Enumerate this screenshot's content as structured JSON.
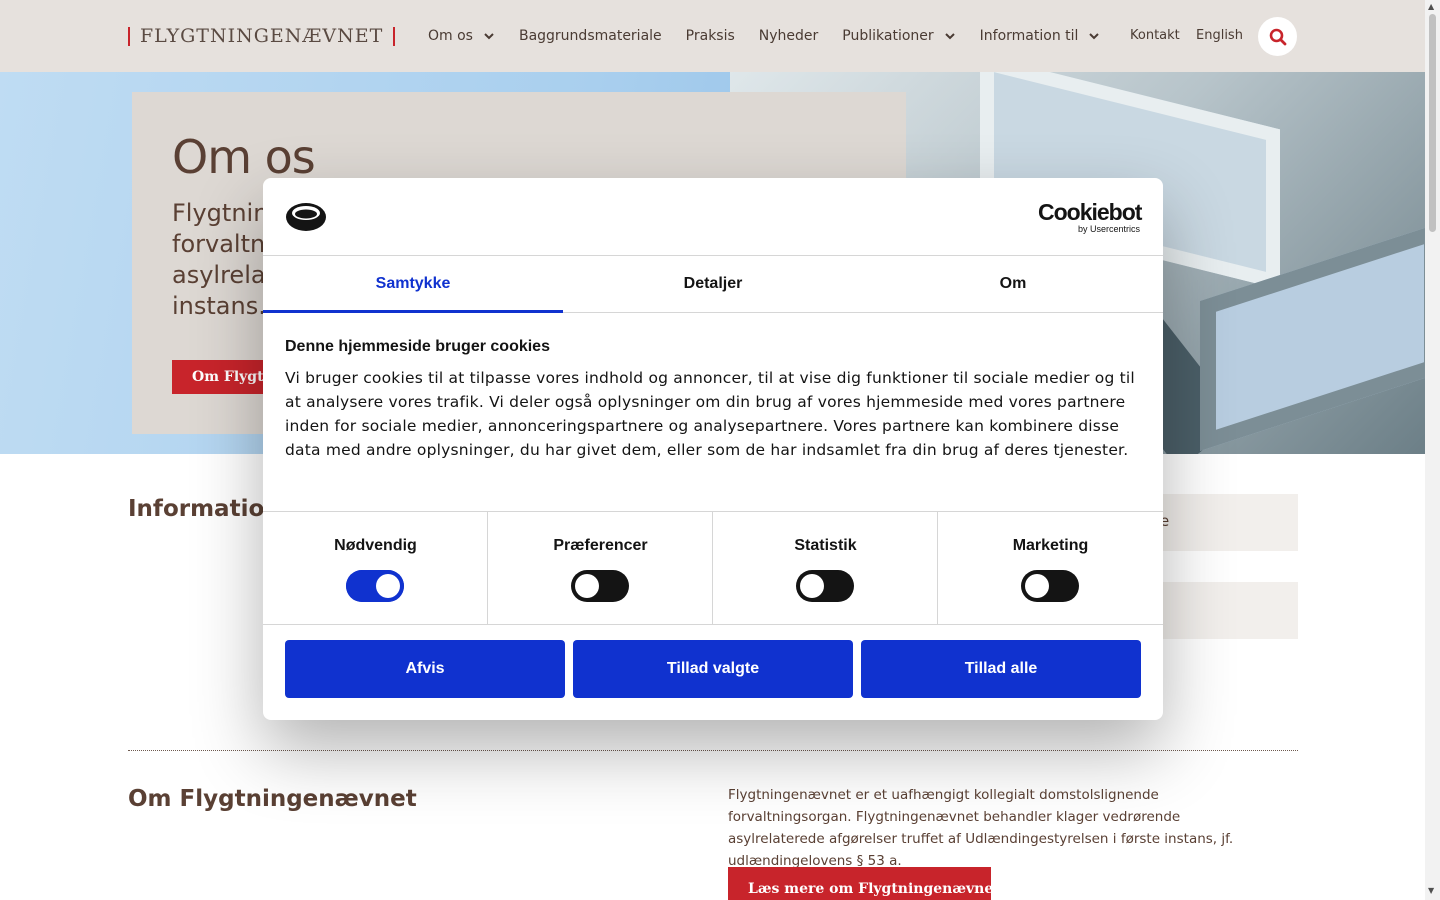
{
  "header": {
    "logo_text": "FLYGTNINGENÆVNET",
    "nav": [
      {
        "label": "Om os",
        "has_dropdown": true
      },
      {
        "label": "Baggrundsmateriale",
        "has_dropdown": false
      },
      {
        "label": "Praksis",
        "has_dropdown": false
      },
      {
        "label": "Nyheder",
        "has_dropdown": false
      },
      {
        "label": "Publikationer",
        "has_dropdown": true
      },
      {
        "label": "Information til",
        "has_dropdown": true
      }
    ],
    "contact": "Kontakt",
    "language": "English",
    "search_icon": "search-icon"
  },
  "hero": {
    "title": "Om os",
    "lead_lines": [
      "Flygtning",
      "forvaltnir",
      "asylrelate",
      "instans."
    ],
    "cta": "Om Flygtn"
  },
  "section": {
    "info_heading": "Information t",
    "side_cards": [
      "e",
      ""
    ]
  },
  "about": {
    "heading": "Om Flygtningenævnet",
    "text": "Flygtningenævnet er et uafhængigt kollegialt domstolslignende forvaltningsorgan. Flygtningenævnet behandler klager vedrørende asylrelaterede afgørelser truffet af Udlændingestyrelsen i første instans, jf. udlændingelovens § 53 a.",
    "cta": "Læs mere om Flygtningenævnet"
  },
  "cookie_dialog": {
    "brand": "Cookiebot",
    "brand_sub": "by Usercentrics",
    "tabs": [
      {
        "label": "Samtykke",
        "active": true
      },
      {
        "label": "Detaljer",
        "active": false
      },
      {
        "label": "Om",
        "active": false
      }
    ],
    "title": "Denne hjemmeside bruger cookies",
    "body": "Vi bruger cookies til at tilpasse vores indhold og annoncer, til at vise dig funktioner til sociale medier og til at analysere vores trafik. Vi deler også oplysninger om din brug af vores hjemmeside med vores partnere inden for sociale medier, annonceringspartnere og analysepartnere. Vores partnere kan kombinere disse data med andre oplysninger, du har givet dem, eller som de har indsamlet fra din brug af deres tjenester.",
    "toggles": [
      {
        "label": "Nødvendig",
        "on": true
      },
      {
        "label": "Præferencer",
        "on": false
      },
      {
        "label": "Statistik",
        "on": false
      },
      {
        "label": "Marketing",
        "on": false
      }
    ],
    "buttons": {
      "reject": "Afvis",
      "allow_selected": "Tillad valgte",
      "allow_all": "Tillad alle"
    }
  },
  "colors": {
    "brand_red": "#c8242b",
    "cookiebot_blue": "#1032cf",
    "header_bg": "#e6e1dd",
    "text_brown": "#5a4034"
  }
}
